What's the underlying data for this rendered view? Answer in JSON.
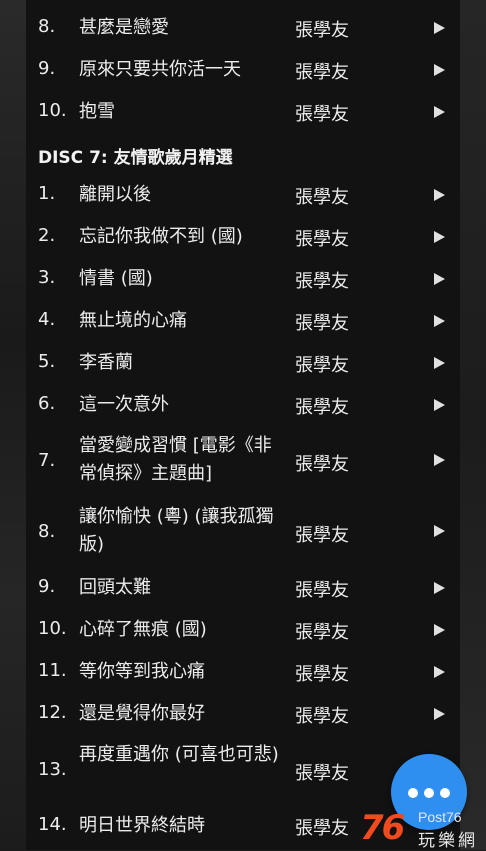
{
  "artist": "張學友",
  "disc_header": "DISC 7: 友情歌歲月精選",
  "tracks_before": [
    {
      "num": "8.",
      "title": "甚麼是戀愛"
    },
    {
      "num": "9.",
      "title": "原來只要共你活一天"
    },
    {
      "num": "10.",
      "title": "抱雪"
    }
  ],
  "tracks_disc7": [
    {
      "num": "1.",
      "title": "離開以後"
    },
    {
      "num": "2.",
      "title": "忘記你我做不到 (國)"
    },
    {
      "num": "3.",
      "title": "情書 (國)"
    },
    {
      "num": "4.",
      "title": "無止境的心痛"
    },
    {
      "num": "5.",
      "title": "李香蘭"
    },
    {
      "num": "6.",
      "title": "這一次意外"
    },
    {
      "num": "7.",
      "title": "當愛變成習慣 [電影《非常偵探》主題曲]"
    },
    {
      "num": "8.",
      "title": "讓你愉快 (粵) (讓我孤獨版)"
    },
    {
      "num": "9.",
      "title": "回頭太難"
    },
    {
      "num": "10.",
      "title": "心碎了無痕 (國)"
    },
    {
      "num": "11.",
      "title": "等你等到我心痛"
    },
    {
      "num": "12.",
      "title": "還是覺得你最好"
    },
    {
      "num": "13.",
      "title": "再度重遇你 (可喜也可悲)"
    },
    {
      "num": "14.",
      "title": "明日世界終結時"
    }
  ],
  "fab_icon": "more-dots-icon",
  "logo": {
    "number": "76",
    "post": "Post76",
    "chinese": "玩樂網"
  },
  "colors": {
    "accent": "#2f8ff0",
    "logo": "#f04a1e"
  }
}
